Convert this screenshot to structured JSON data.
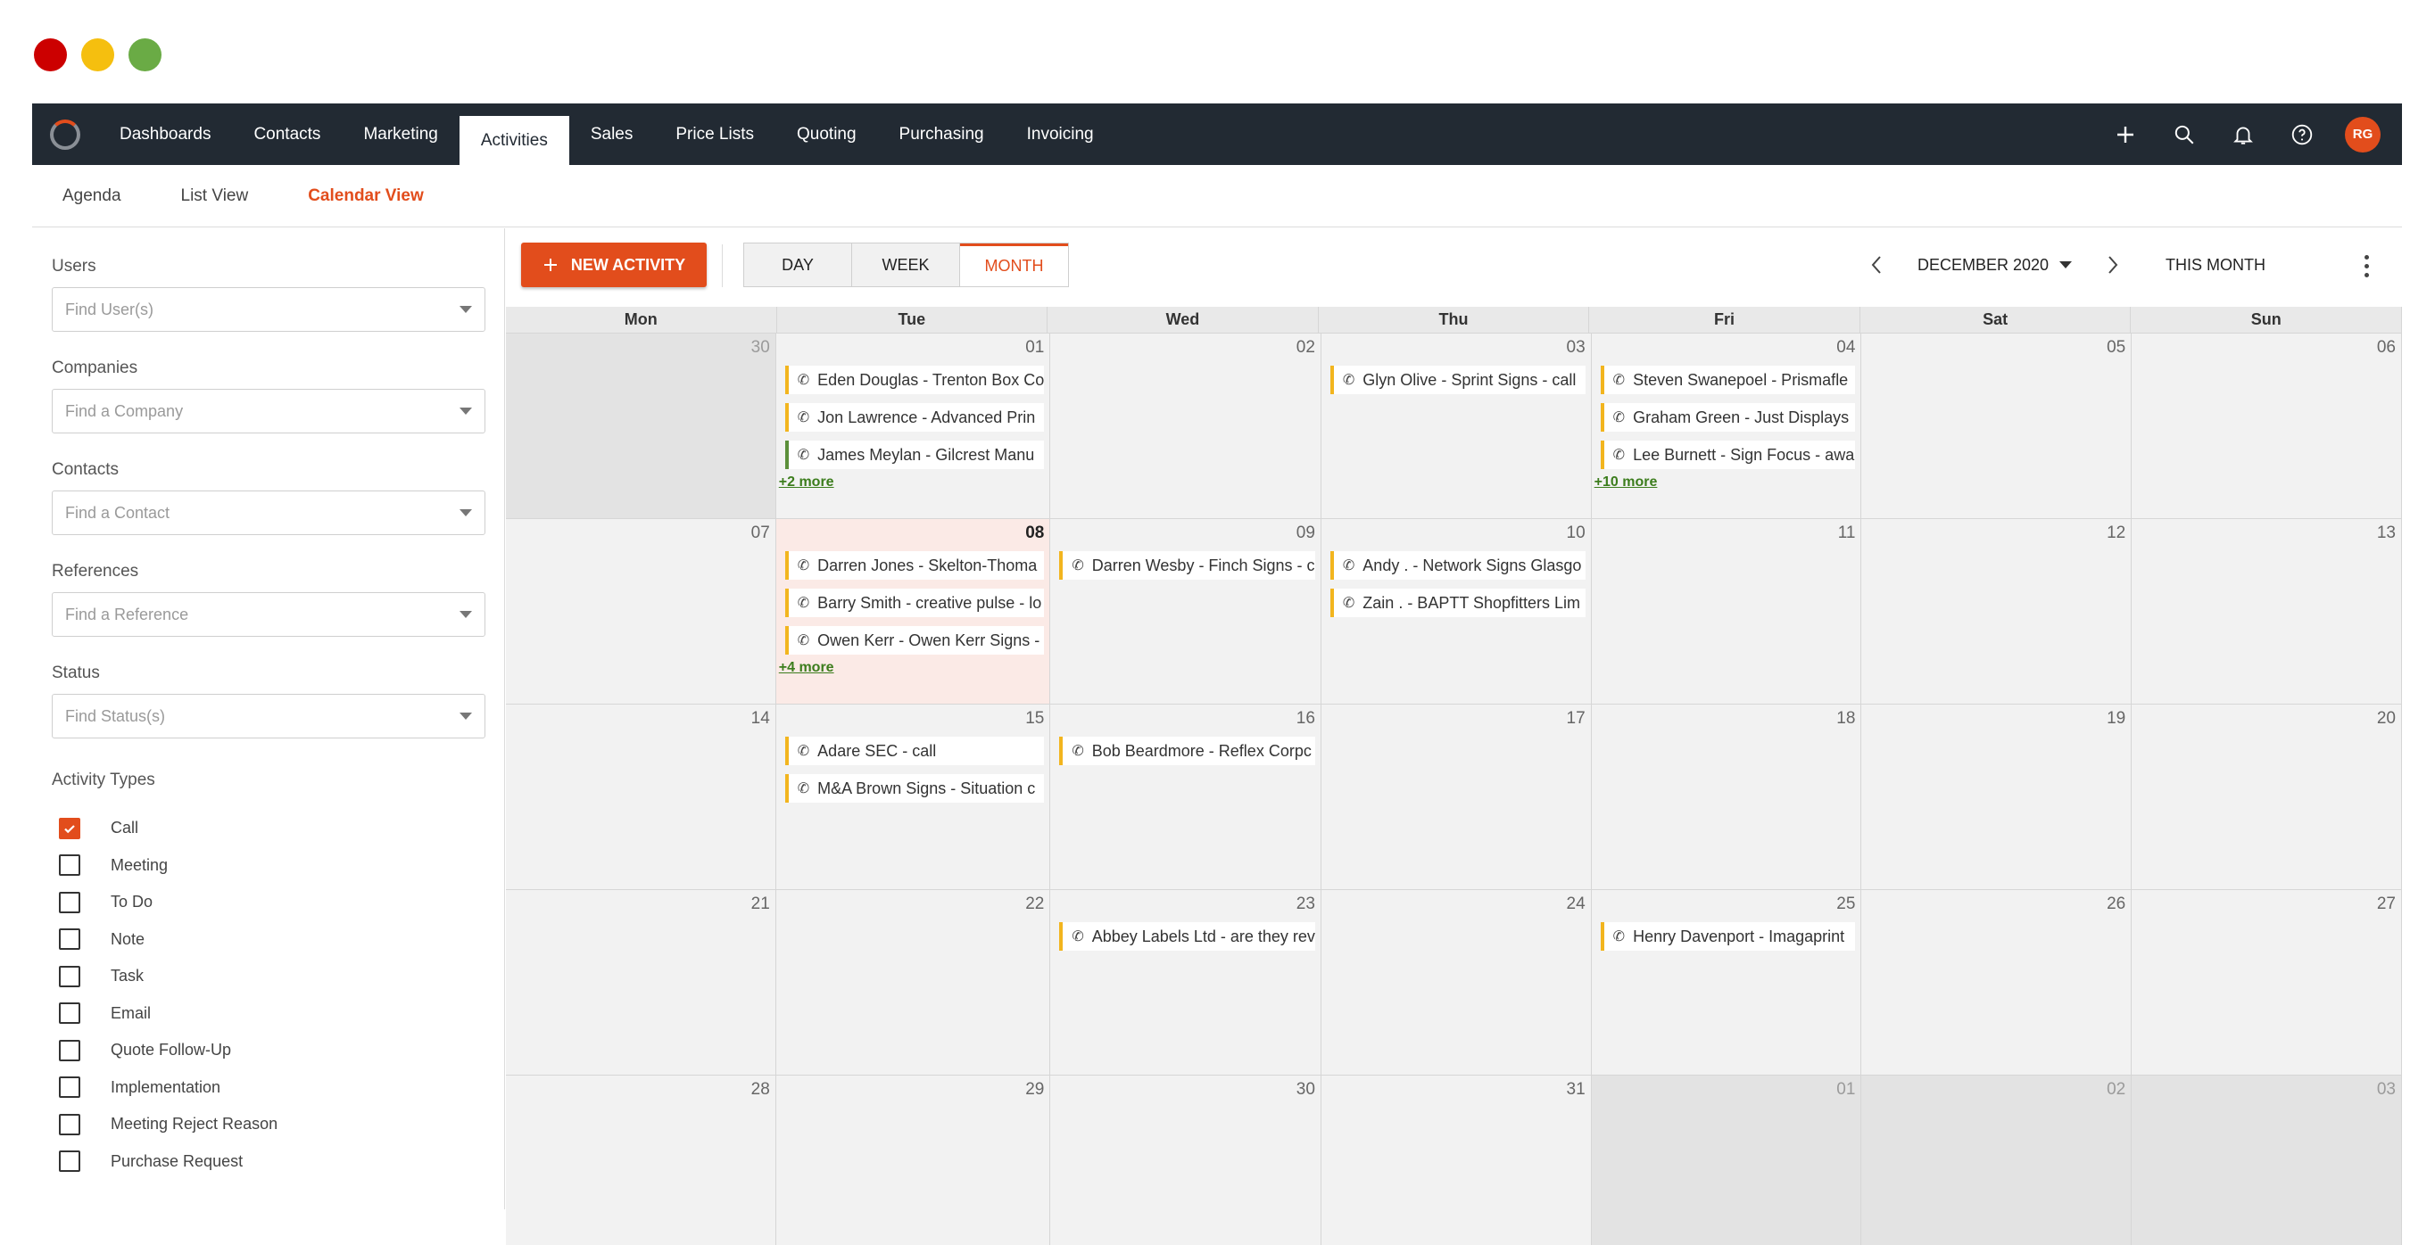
{
  "window_controls": [
    {
      "name": "close",
      "color": "#cc0000"
    },
    {
      "name": "minimize",
      "color": "#f5bf0f"
    },
    {
      "name": "maximize",
      "color": "#6aab45"
    }
  ],
  "topnav": {
    "items": [
      {
        "label": "Dashboards",
        "active": false
      },
      {
        "label": "Contacts",
        "active": false
      },
      {
        "label": "Marketing",
        "active": false
      },
      {
        "label": "Activities",
        "active": true
      },
      {
        "label": "Sales",
        "active": false
      },
      {
        "label": "Price Lists",
        "active": false
      },
      {
        "label": "Quoting",
        "active": false
      },
      {
        "label": "Purchasing",
        "active": false
      },
      {
        "label": "Invoicing",
        "active": false
      }
    ],
    "icons": [
      "plus-icon",
      "search-icon",
      "bell-icon",
      "help-icon"
    ],
    "avatar_initials": "RG",
    "accent": "#e24d1c",
    "bg": "#222a33"
  },
  "subnav": {
    "items": [
      {
        "label": "Agenda",
        "active": false
      },
      {
        "label": "List View",
        "active": false
      },
      {
        "label": "Calendar View",
        "active": true
      }
    ]
  },
  "filters": {
    "users": {
      "label": "Users",
      "placeholder": "Find User(s)"
    },
    "companies": {
      "label": "Companies",
      "placeholder": "Find a Company"
    },
    "contacts": {
      "label": "Contacts",
      "placeholder": "Find a Contact"
    },
    "references": {
      "label": "References",
      "placeholder": "Find a Reference"
    },
    "status": {
      "label": "Status",
      "placeholder": "Find Status(s)"
    }
  },
  "activity_types": {
    "label": "Activity Types",
    "items": [
      {
        "label": "Call",
        "checked": true
      },
      {
        "label": "Meeting",
        "checked": false
      },
      {
        "label": "To Do",
        "checked": false
      },
      {
        "label": "Note",
        "checked": false
      },
      {
        "label": "Task",
        "checked": false
      },
      {
        "label": "Email",
        "checked": false
      },
      {
        "label": "Quote Follow-Up",
        "checked": false
      },
      {
        "label": "Implementation",
        "checked": false
      },
      {
        "label": "Meeting Reject Reason",
        "checked": false
      },
      {
        "label": "Purchase Request",
        "checked": false
      }
    ]
  },
  "toolbar": {
    "new_activity": "NEW ACTIVITY",
    "views": [
      {
        "label": "DAY",
        "active": false
      },
      {
        "label": "WEEK",
        "active": false
      },
      {
        "label": "MONTH",
        "active": true
      }
    ],
    "month_label": "DECEMBER 2020",
    "this_month": "THIS MONTH"
  },
  "calendar": {
    "day_names": [
      "Mon",
      "Tue",
      "Wed",
      "Thu",
      "Fri",
      "Sat",
      "Sun"
    ],
    "weeks": [
      [
        {
          "date": "30",
          "other": true,
          "events": []
        },
        {
          "date": "01",
          "events": [
            {
              "text": "Eden Douglas - Trenton Box Co"
            },
            {
              "text": "Jon Lawrence - Advanced Prin"
            },
            {
              "text": "James Meylan - Gilcrest Manu",
              "color": "green"
            }
          ],
          "more": "+2 more"
        },
        {
          "date": "02",
          "events": []
        },
        {
          "date": "03",
          "events": [
            {
              "text": "Glyn Olive - Sprint Signs - call"
            }
          ]
        },
        {
          "date": "04",
          "events": [
            {
              "text": "Steven Swanepoel - Prismafle"
            },
            {
              "text": "Graham Green - Just Displays"
            },
            {
              "text": "Lee Burnett - Sign Focus - awa"
            }
          ],
          "more": "+10 more"
        },
        {
          "date": "05",
          "events": []
        },
        {
          "date": "06",
          "events": []
        }
      ],
      [
        {
          "date": "07",
          "events": []
        },
        {
          "date": "08",
          "today": true,
          "events": [
            {
              "text": "Darren Jones - Skelton-Thoma"
            },
            {
              "text": "Barry Smith - creative pulse - lo"
            },
            {
              "text": "Owen Kerr - Owen Kerr Signs -"
            }
          ],
          "more": "+4 more"
        },
        {
          "date": "09",
          "events": [
            {
              "text": "Darren Wesby - Finch Signs - c"
            }
          ]
        },
        {
          "date": "10",
          "events": [
            {
              "text": "Andy . - Network Signs Glasgo"
            },
            {
              "text": "Zain . - BAPTT Shopfitters Lim"
            }
          ]
        },
        {
          "date": "11",
          "events": []
        },
        {
          "date": "12",
          "events": []
        },
        {
          "date": "13",
          "events": []
        }
      ],
      [
        {
          "date": "14",
          "events": []
        },
        {
          "date": "15",
          "events": [
            {
              "text": "Adare SEC - call"
            },
            {
              "text": "M&A Brown Signs - Situation c"
            }
          ]
        },
        {
          "date": "16",
          "events": [
            {
              "text": "Bob Beardmore - Reflex Corpc"
            }
          ]
        },
        {
          "date": "17",
          "events": []
        },
        {
          "date": "18",
          "events": []
        },
        {
          "date": "19",
          "events": []
        },
        {
          "date": "20",
          "events": []
        }
      ],
      [
        {
          "date": "21",
          "events": []
        },
        {
          "date": "22",
          "events": []
        },
        {
          "date": "23",
          "events": [
            {
              "text": "Abbey Labels Ltd - are they rev"
            }
          ]
        },
        {
          "date": "24",
          "events": []
        },
        {
          "date": "25",
          "events": [
            {
              "text": "Henry Davenport - Imagaprint"
            }
          ]
        },
        {
          "date": "26",
          "events": []
        },
        {
          "date": "27",
          "events": []
        }
      ],
      [
        {
          "date": "28",
          "events": []
        },
        {
          "date": "29",
          "events": []
        },
        {
          "date": "30",
          "events": []
        },
        {
          "date": "31",
          "events": []
        },
        {
          "date": "01",
          "other": true,
          "events": []
        },
        {
          "date": "02",
          "other": true,
          "events": []
        },
        {
          "date": "03",
          "other": true,
          "events": []
        }
      ]
    ]
  }
}
